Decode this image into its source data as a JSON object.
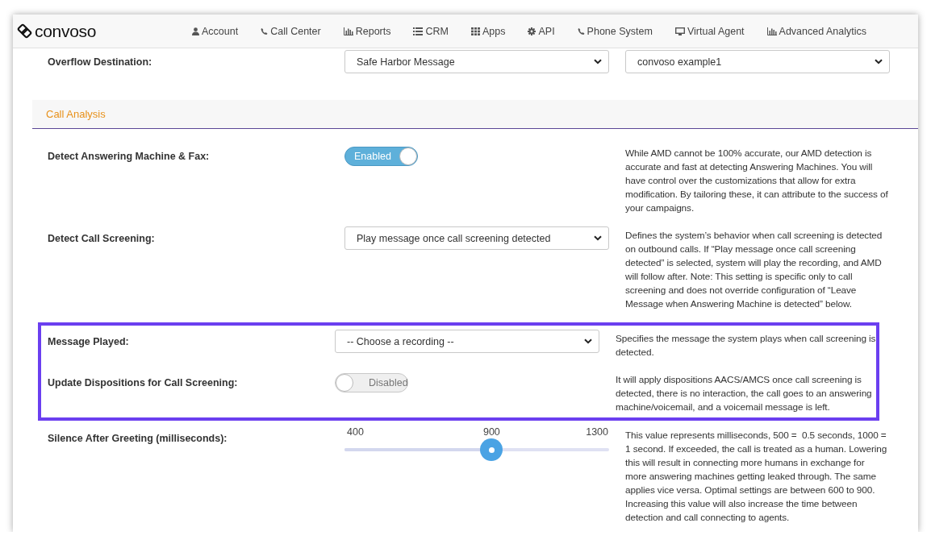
{
  "brand": "convoso",
  "nav": [
    {
      "label": "Account"
    },
    {
      "label": "Call Center"
    },
    {
      "label": "Reports"
    },
    {
      "label": "CRM"
    },
    {
      "label": "Apps"
    },
    {
      "label": "API"
    },
    {
      "label": "Phone System"
    },
    {
      "label": "Virtual Agent"
    },
    {
      "label": "Advanced Analytics"
    }
  ],
  "top_row": {
    "kind": "select",
    "label": "Overflow Destination:",
    "selects": [
      {
        "value": "Safe Harbor Message"
      },
      {
        "value": "convoso example1"
      }
    ]
  },
  "section": {
    "title": "Call Analysis"
  },
  "rows": [
    {
      "kind": "toggle",
      "highlighted": false,
      "label": "Detect Answering Machine & Fax:",
      "on": true,
      "state_text": "Enabled",
      "description": "While AMD cannot be 100% accurate, our AMD detection is accurate and fast at detecting Answering Machines. You will have control over the customizations that allow for extra modification. By tailoring these, it can attribute to the success of your campaigns."
    },
    {
      "kind": "select",
      "highlighted": false,
      "label": "Detect Call Screening:",
      "selects": [
        {
          "value": "Play message once call screening detected"
        }
      ],
      "description": "Defines the system’s behavior when call screening is detected on outbound calls. If “Play message once call screening detected” is selected, system will play the recording, and AMD will follow after. Note: This setting is specific only to call screening and does not override configuration of “Leave Message when Answering Machine is detected” below."
    },
    {
      "kind": "select",
      "highlighted": true,
      "label": "Message Played:",
      "selects": [
        {
          "value": "-- Choose a recording --"
        }
      ],
      "description": "Specifies the message the system plays when call screening is detected."
    },
    {
      "kind": "toggle",
      "highlighted": true,
      "label": "Update Dispositions for Call Screening:",
      "on": false,
      "state_text": "Disabled",
      "description": "It will apply dispositions AACS/AMCS once call screening is detected, there is no interaction, the call goes to an answering machine/voicemail, and a voicemail message is left."
    },
    {
      "kind": "slider",
      "highlighted": false,
      "label": "Silence After Greeting (milliseconds):",
      "min_label": "400",
      "value_label": "900",
      "max_label": "1300",
      "level": 0.556,
      "description": "This value represents milliseconds, 500 =  0.5 seconds, 1000 = 1 second. If exceeded, the call is treated as a human. Lowering this will result in connecting more humans in exchange for more answering machines getting leaked through. The same applies vice versa. Optimal settings are between 600 to 900. Increasing this value will also increase the time between detection and call connecting to agents."
    }
  ]
}
